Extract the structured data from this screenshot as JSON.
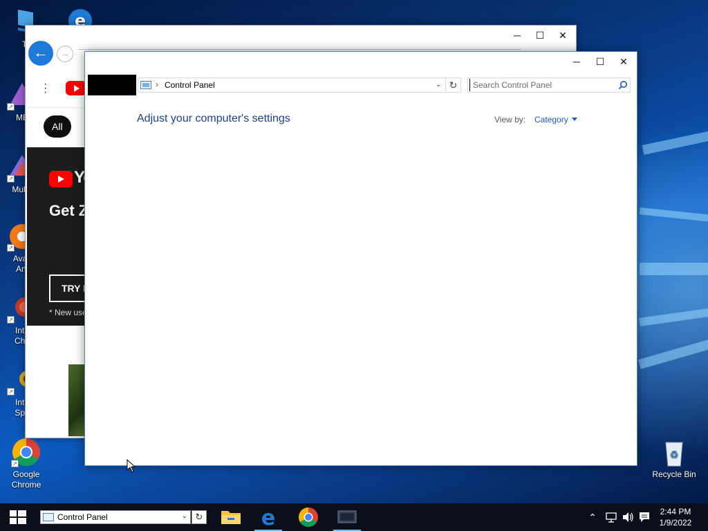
{
  "desktop": {
    "icons": [
      {
        "label": "Thi"
      },
      {
        "label": "ME"
      },
      {
        "label": "Multi-"
      },
      {
        "label": "Avas Ant"
      },
      {
        "label": "Inte Che"
      },
      {
        "label": "Inte Spa"
      },
      {
        "label": "Google Chrome"
      },
      {
        "label": "Recycle Bin"
      }
    ]
  },
  "browser": {
    "chip_all": "All",
    "promo": {
      "logo_text": "Yo",
      "headline": "Get Z dema",
      "try_button": "TRY I",
      "note": "* New use"
    }
  },
  "control_panel": {
    "breadcrumb": "Control Panel",
    "search_placeholder": "Search Control Panel",
    "heading": "Adjust your computer's settings",
    "view_by_label": "View by:",
    "view_by_value": "Category"
  },
  "taskbar": {
    "address_label": "Control Panel",
    "clock": {
      "time": "2:44 PM",
      "date": "1/9/2022"
    }
  },
  "colors": {
    "accent": "#1e5bb4",
    "heading": "#1e3f8a",
    "taskbar": "#0b0f1a"
  }
}
